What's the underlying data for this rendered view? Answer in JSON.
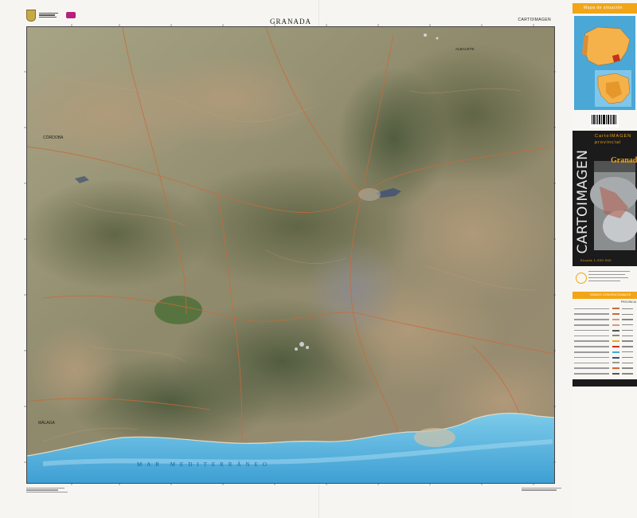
{
  "sheet": {
    "title": "GRANADA",
    "series_label": "CARTOIMAGEN"
  },
  "map": {
    "sea_label": "MAR MEDITERRÁNEO",
    "places": {
      "cordoba": "CÓRDOBA",
      "malaga": "MÁLAGA",
      "albacete": "ALBACETE"
    }
  },
  "panel": {
    "location_header": "Mapa de situación",
    "cover_brand": "CARTOIMAGEN",
    "cover_title": "CartoIMAGEN",
    "cover_subtitle": "provincial",
    "cover_province": "Granada",
    "cover_scale": "Escala 1:200.000",
    "legend_header": "SIGNOS CONVENCIONALES",
    "legend_subheader": "PROVINCIA"
  },
  "colors": {
    "accent": "#f2a516",
    "sea": "#4aa7d6",
    "panel_dark": "#1b1b1b",
    "land": "#8e8a6e"
  }
}
